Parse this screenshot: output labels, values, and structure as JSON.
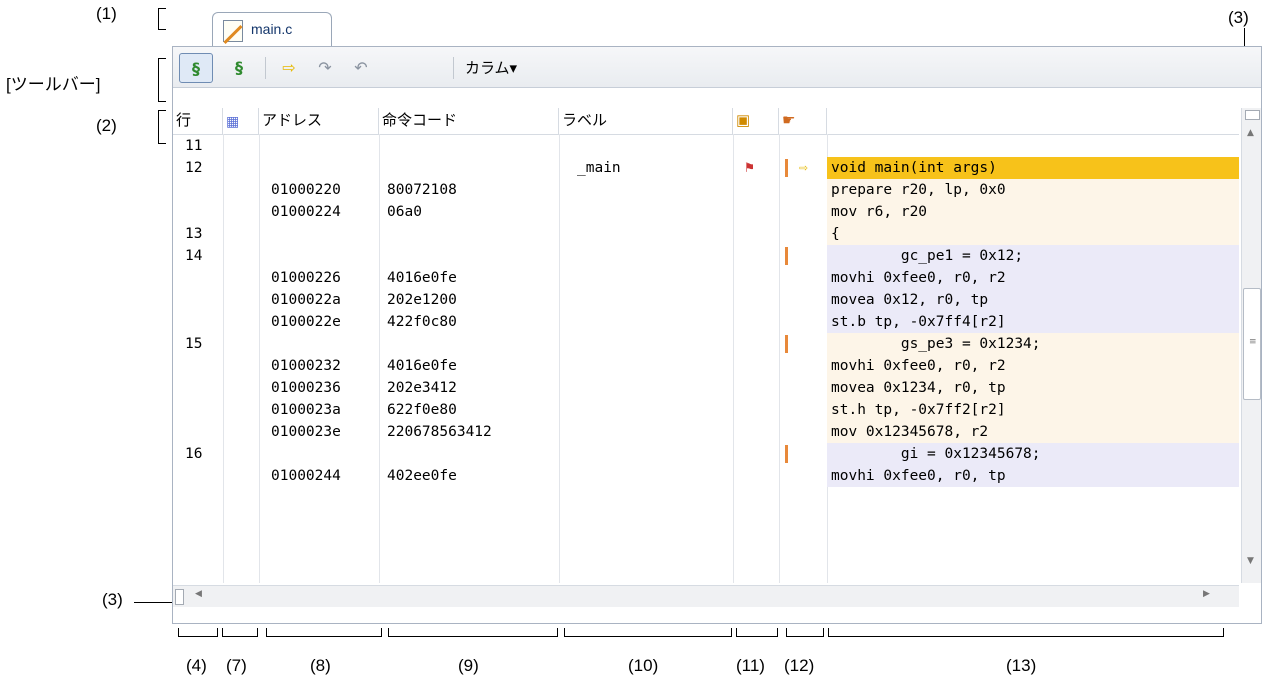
{
  "annotations": {
    "a1": "(1)",
    "toolbar": "[ツールバー]",
    "a2": "(2)",
    "a3_top": "(3)",
    "a3_left": "(3)",
    "bottom": [
      "(4)",
      "(7)",
      "(8)",
      "(9)",
      "(10)",
      "(11)",
      "(12)",
      "(13)"
    ]
  },
  "tab": {
    "label": "main.c"
  },
  "toolbar": {
    "column_label": "カラム▾"
  },
  "header": {
    "line": "行",
    "address": "アドレス",
    "opcode": "命令コード",
    "label": "ラベル"
  },
  "rows": [
    {
      "line": "11",
      "addr": "",
      "code": "",
      "label": "",
      "src": "",
      "bg": "none"
    },
    {
      "line": "12",
      "addr": "",
      "code": "",
      "label": "_main",
      "src": "void main(int args)",
      "bg": "current"
    },
    {
      "line": "",
      "addr": "01000220",
      "code": "80072108",
      "label": "",
      "src": "prepare r20, lp, 0x0",
      "bg": "peach"
    },
    {
      "line": "",
      "addr": "01000224",
      "code": "06a0",
      "label": "",
      "src": "mov r6, r20",
      "bg": "peach"
    },
    {
      "line": "13",
      "addr": "",
      "code": "",
      "label": "",
      "src": "{",
      "bg": "peach"
    },
    {
      "line": "14",
      "addr": "",
      "code": "",
      "label": "",
      "src": "        gc_pe1 = 0x12;",
      "bg": "lavender"
    },
    {
      "line": "",
      "addr": "01000226",
      "code": "4016e0fe",
      "label": "",
      "src": "movhi 0xfee0, r0, r2",
      "bg": "lavender"
    },
    {
      "line": "",
      "addr": "0100022a",
      "code": "202e1200",
      "label": "",
      "src": "movea 0x12, r0, tp",
      "bg": "lavender"
    },
    {
      "line": "",
      "addr": "0100022e",
      "code": "422f0c80",
      "label": "",
      "src": "st.b tp, -0x7ff4[r2]",
      "bg": "lavender"
    },
    {
      "line": "15",
      "addr": "",
      "code": "",
      "label": "",
      "src": "        gs_pe3 = 0x1234;",
      "bg": "peach"
    },
    {
      "line": "",
      "addr": "01000232",
      "code": "4016e0fe",
      "label": "",
      "src": "movhi 0xfee0, r0, r2",
      "bg": "peach"
    },
    {
      "line": "",
      "addr": "01000236",
      "code": "202e3412",
      "label": "",
      "src": "movea 0x1234, r0, tp",
      "bg": "peach"
    },
    {
      "line": "",
      "addr": "0100023a",
      "code": "622f0e80",
      "label": "",
      "src": "st.h tp, -0x7ff2[r2]",
      "bg": "peach"
    },
    {
      "line": "",
      "addr": "0100023e",
      "code": "220678563412",
      "label": "",
      "src": "mov 0x12345678, r2",
      "bg": "peach"
    },
    {
      "line": "16",
      "addr": "",
      "code": "",
      "label": "",
      "src": "        gi = 0x12345678;",
      "bg": "lavender"
    },
    {
      "line": "",
      "addr": "01000244",
      "code": "402ee0fe",
      "label": "",
      "src": "movhi 0xfee0, r0, tp",
      "bg": "lavender"
    }
  ],
  "colors": {
    "current": "#f7c21a",
    "peach": "#fdf5e8",
    "lavender": "#ebeaf8",
    "marker": "#e8893a"
  }
}
